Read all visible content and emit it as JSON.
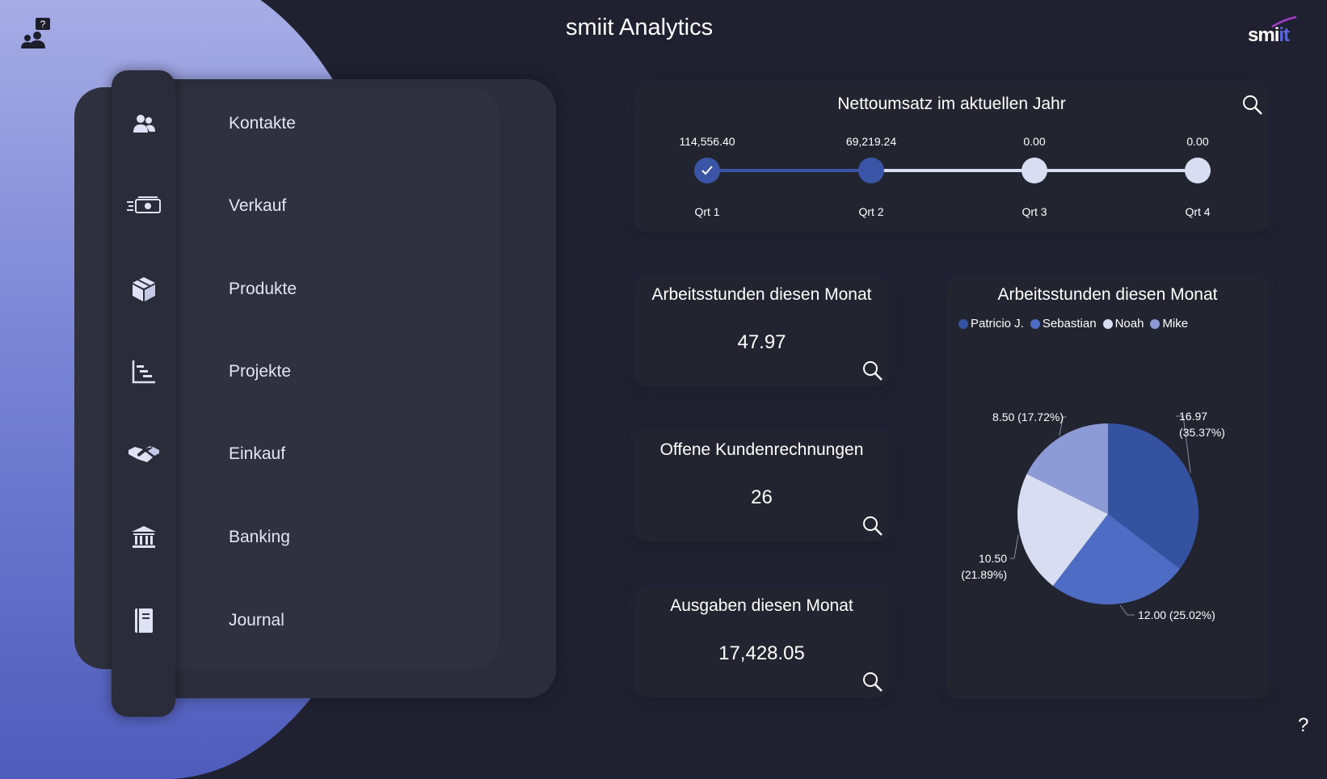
{
  "app": {
    "title": "smiit Analytics",
    "logo_text_white": "smi",
    "logo_text_blue": "it",
    "help": "?"
  },
  "colors": {
    "accent": "#3a55a6",
    "accent_light": "#5b73c9",
    "pale": "#d9ddf2",
    "muted": "#8c9bd6"
  },
  "sidebar": {
    "items": [
      {
        "label": "Kontakte",
        "icon": "contacts-icon"
      },
      {
        "label": "Verkauf",
        "icon": "money-icon"
      },
      {
        "label": "Produkte",
        "icon": "box-icon"
      },
      {
        "label": "Projekte",
        "icon": "gantt-icon"
      },
      {
        "label": "Einkauf",
        "icon": "handshake-icon"
      },
      {
        "label": "Banking",
        "icon": "bank-icon"
      },
      {
        "label": "Journal",
        "icon": "journal-icon"
      }
    ]
  },
  "revenue": {
    "title": "Nettoumsatz im aktuellen Jahr",
    "quarters": [
      {
        "label": "Qrt 1",
        "value": "114,556.40",
        "state": "completed"
      },
      {
        "label": "Qrt 2",
        "value": "69,219.24",
        "state": "current"
      },
      {
        "label": "Qrt 3",
        "value": "0.00",
        "state": "pending"
      },
      {
        "label": "Qrt 4",
        "value": "0.00",
        "state": "pending"
      }
    ]
  },
  "kpis": [
    {
      "title": "Arbeitsstunden diesen Monat",
      "value": "47.97"
    },
    {
      "title": "Offene Kundenrechnungen",
      "value": "26"
    },
    {
      "title": "Ausgaben diesen Monat",
      "value": "17,428.05"
    }
  ],
  "pie": {
    "title": "Arbeitsstunden diesen Monat",
    "legend": [
      "Patricio J.",
      "Sebastian",
      "Noah",
      "Mike"
    ]
  },
  "chart_data": {
    "type": "pie",
    "title": "Arbeitsstunden diesen Monat",
    "series": [
      {
        "name": "Patricio J.",
        "value": 16.97,
        "percent": 35.37,
        "label_value": "16.97",
        "label_pct": "(35.37%)",
        "color": "#3552a0"
      },
      {
        "name": "Sebastian",
        "value": 12.0,
        "percent": 25.02,
        "label_value": "12.00",
        "label_pct": "(25.02%)",
        "color": "#4e6cc4"
      },
      {
        "name": "Noah",
        "value": 10.5,
        "percent": 21.89,
        "label_value": "10.50",
        "label_pct": "(21.89%)",
        "color": "#d9ddf2"
      },
      {
        "name": "Mike",
        "value": 8.5,
        "percent": 17.72,
        "label_value": "8.50",
        "label_pct": "(17.72%)",
        "color": "#8c9bd6"
      }
    ],
    "legend_position": "top-left"
  }
}
